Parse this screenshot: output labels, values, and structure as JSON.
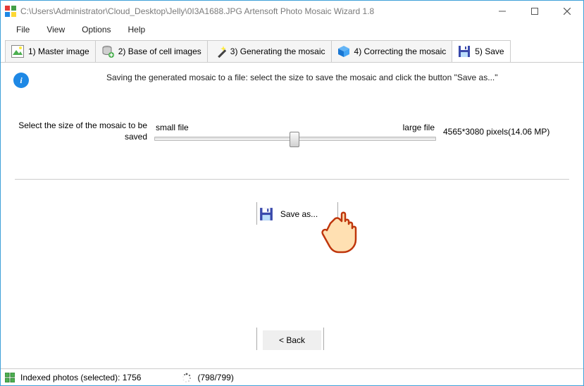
{
  "window": {
    "title": "C:\\Users\\Administrator\\Cloud_Desktop\\Jelly\\0I3A1688.JPG Artensoft Photo Mosaic Wizard 1.8"
  },
  "menu": {
    "file": "File",
    "view": "View",
    "options": "Options",
    "help": "Help"
  },
  "tabs": {
    "t1": "1) Master image",
    "t2": "2) Base of cell images",
    "t3": "3) Generating the mosaic",
    "t4": "4) Correcting the mosaic",
    "t5": "5) Save"
  },
  "info": {
    "text": "Saving the generated mosaic to a file: select the size to save the mosaic and click the button \"Save as...\""
  },
  "slider": {
    "caption": "Select the size of the mosaic to be saved",
    "small": "small file",
    "large": "large file",
    "value_text": "4565*3080 pixels(14.06 MP)"
  },
  "buttons": {
    "save_as": "Save as...",
    "back": "< Back"
  },
  "status": {
    "indexed": "Indexed photos (selected): 1756",
    "progress": "(798/799)"
  }
}
